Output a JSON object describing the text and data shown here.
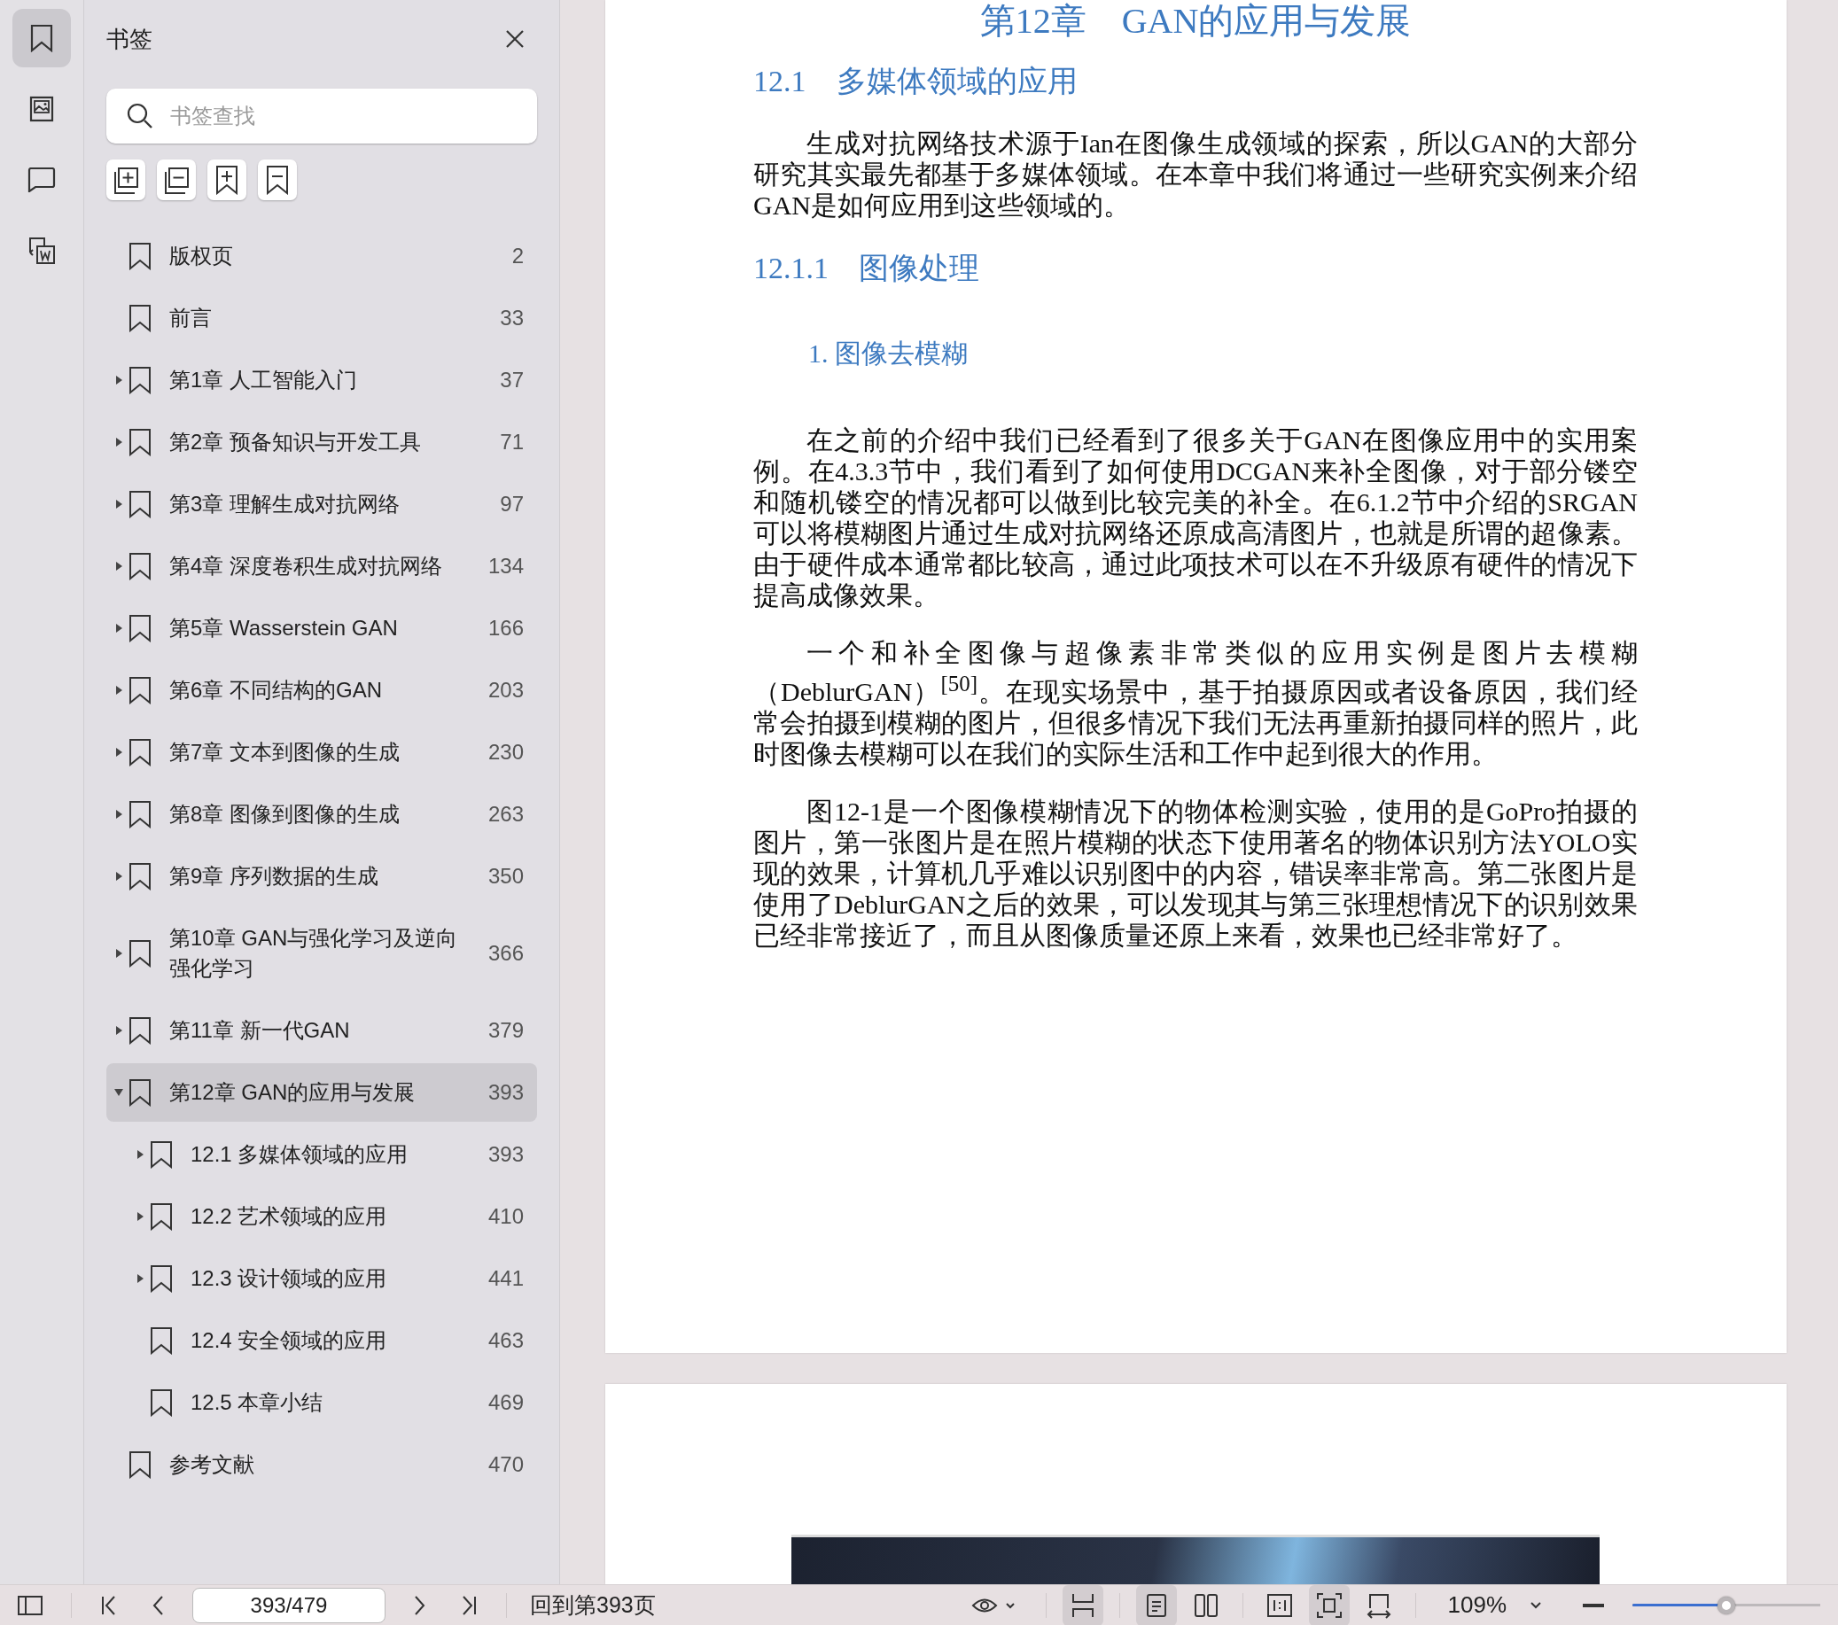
{
  "rail": {
    "tabs": [
      {
        "kind": "bookmarks",
        "selected": true
      },
      {
        "kind": "thumbnails",
        "selected": false
      },
      {
        "kind": "comments",
        "selected": false
      },
      {
        "kind": "convert",
        "selected": false
      }
    ]
  },
  "bookmarks_panel": {
    "title": "书签",
    "search": {
      "placeholder": "书签查找"
    },
    "items": [
      {
        "label": "版权页",
        "page": "2",
        "kind": "leaf",
        "selected": false
      },
      {
        "label": "前言",
        "page": "33",
        "kind": "leaf",
        "selected": false
      },
      {
        "label": "第1章 人工智能入门",
        "page": "37",
        "kind": "group",
        "expanded": false,
        "selected": false
      },
      {
        "label": "第2章 预备知识与开发工具",
        "page": "71",
        "kind": "group",
        "expanded": false,
        "selected": false
      },
      {
        "label": "第3章 理解生成对抗网络",
        "page": "97",
        "kind": "group",
        "expanded": false,
        "selected": false
      },
      {
        "label": "第4章 深度卷积生成对抗网络",
        "page": "134",
        "kind": "group",
        "expanded": false,
        "selected": false
      },
      {
        "label": "第5章 Wasserstein GAN",
        "page": "166",
        "kind": "group",
        "expanded": false,
        "selected": false
      },
      {
        "label": "第6章 不同结构的GAN",
        "page": "203",
        "kind": "group",
        "expanded": false,
        "selected": false
      },
      {
        "label": "第7章 文本到图像的生成",
        "page": "230",
        "kind": "group",
        "expanded": false,
        "selected": false
      },
      {
        "label": "第8章 图像到图像的生成",
        "page": "263",
        "kind": "group",
        "expanded": false,
        "selected": false
      },
      {
        "label": "第9章 序列数据的生成",
        "page": "350",
        "kind": "group",
        "expanded": false,
        "selected": false
      },
      {
        "label": "第10章 GAN与强化学习及逆向强化学习",
        "page": "366",
        "kind": "group",
        "expanded": false,
        "selected": false
      },
      {
        "label": "第11章 新一代GAN",
        "page": "379",
        "kind": "group",
        "expanded": false,
        "selected": false
      },
      {
        "label": "第12章 GAN的应用与发展",
        "page": "393",
        "kind": "group",
        "expanded": true,
        "selected": true,
        "children": [
          {
            "label": "12.1 多媒体领域的应用",
            "page": "393",
            "kind": "group",
            "expanded": false,
            "selected": false
          },
          {
            "label": "12.2 艺术领域的应用",
            "page": "410",
            "kind": "group",
            "expanded": false,
            "selected": false
          },
          {
            "label": "12.3 设计领域的应用",
            "page": "441",
            "kind": "group",
            "expanded": false,
            "selected": false
          },
          {
            "label": "12.4 安全领域的应用",
            "page": "463",
            "kind": "leaf",
            "selected": false
          },
          {
            "label": "12.5 本章小结",
            "page": "469",
            "kind": "leaf",
            "selected": false
          }
        ]
      },
      {
        "label": "参考文献",
        "page": "470",
        "kind": "leaf",
        "selected": false
      }
    ]
  },
  "document": {
    "pages": [
      {
        "blocks": [
          {
            "kind": "chapter",
            "number": "第12章",
            "text": "GAN的应用与发展"
          },
          {
            "kind": "section",
            "number": "12.1",
            "text": "多媒体领域的应用"
          },
          {
            "kind": "para",
            "text": "生成对抗网络技术源于Ian在图像生成领域的探索，所以GAN的大部分研究其实最先都基于多媒体领域。在本章中我们将通过一些研究实例来介绍GAN是如何应用到这些领域的。"
          },
          {
            "kind": "subsection",
            "number": "12.1.1",
            "text": "图像处理"
          },
          {
            "kind": "topic",
            "text": "1. 图像去模糊"
          },
          {
            "kind": "para",
            "text": "在之前的介绍中我们已经看到了很多关于GAN在图像应用中的实用案例。在4.3.3节中，我们看到了如何使用DCGAN来补全图像，对于部分镂空和随机镂空的情况都可以做到比较完美的补全。在6.1.2节中介绍的SRGAN可以将模糊图片通过生成对抗网络还原成高清图片，也就是所谓的超像素。由于硬件成本通常都比较高，通过此项技术可以在不升级原有硬件的情况下提高成像效果。"
          },
          {
            "kind": "para",
            "text": "一个和补全图像与超像素非常类似的应用实例是图片去模糊（DeblurGAN）$^{[50]}$。在现实场景中，基于拍摄原因或者设备原因，我们经常会拍摄到模糊的图片，但很多情况下我们无法再重新拍摄同样的照片，此时图像去模糊可以在我们的实际生活和工作中起到很大的作用。"
          },
          {
            "kind": "para",
            "text": "图12-1是一个图像模糊情况下的物体检测实验，使用的是GoPro拍摄的图片，第一张图片是在照片模糊的状态下使用著名的物体识别方法YOLO实现的效果，计算机几乎难以识别图中的内容，错误率非常高。第二张图片是使用了DeblurGAN之后的效果，可以发现其与第三张理想情况下的识别效果已经非常接近了，而且从图像质量还原上来看，效果也已经非常好了。"
          }
        ]
      },
      {
        "blocks": [
          {
            "kind": "photo"
          }
        ]
      }
    ]
  },
  "status_bar": {
    "page_field": {
      "value": "393/479"
    },
    "goto_link": "回到第393页",
    "view_groups": [
      [
        {
          "kind": "continuous",
          "selected": true
        }
      ],
      [
        {
          "kind": "single",
          "selected": true
        },
        {
          "kind": "double",
          "selected": false
        }
      ],
      [
        {
          "kind": "actual",
          "selected": false
        },
        {
          "kind": "fit-page",
          "selected": true
        },
        {
          "kind": "fit-width",
          "selected": false
        }
      ]
    ],
    "zoom": {
      "value": "109%",
      "level": 0.5
    }
  }
}
